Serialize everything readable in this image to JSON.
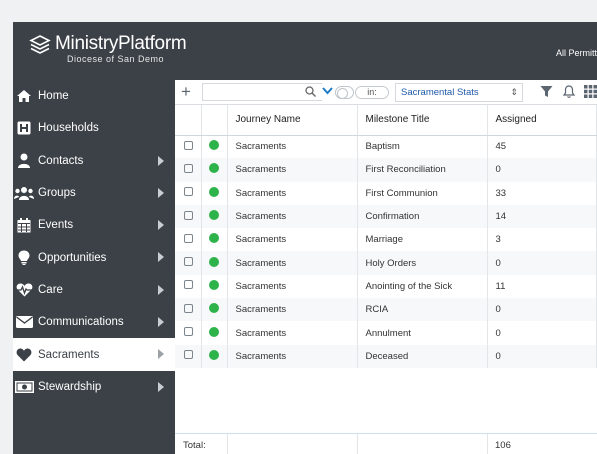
{
  "app": {
    "name": "MinistryPlatform",
    "subtitle": "Diocese of San Demo",
    "permissions": "All Permitt"
  },
  "sidebar": {
    "items": [
      {
        "label": "Home",
        "icon": "home-icon",
        "has_chevron": false
      },
      {
        "label": "Households",
        "icon": "household-icon",
        "has_chevron": false
      },
      {
        "label": "Contacts",
        "icon": "person-icon",
        "has_chevron": true
      },
      {
        "label": "Groups",
        "icon": "group-icon",
        "has_chevron": true
      },
      {
        "label": "Events",
        "icon": "calendar-icon",
        "has_chevron": true
      },
      {
        "label": "Opportunities",
        "icon": "lightbulb-icon",
        "has_chevron": true
      },
      {
        "label": "Care",
        "icon": "heartbeat-icon",
        "has_chevron": true
      },
      {
        "label": "Communications",
        "icon": "envelope-icon",
        "has_chevron": true
      },
      {
        "label": "Sacraments",
        "icon": "heart-icon",
        "has_chevron": true,
        "active": true
      },
      {
        "label": "Stewardship",
        "icon": "money-icon",
        "has_chevron": true
      }
    ]
  },
  "toolbar": {
    "filter_in_label": "in:",
    "selected_view": "Sacramental Stats"
  },
  "table": {
    "columns": [
      "Journey Name",
      "Milestone Title",
      "Assigned"
    ],
    "rows": [
      {
        "journey": "Sacraments",
        "milestone": "Baptism",
        "assigned": "45"
      },
      {
        "journey": "Sacraments",
        "milestone": "First Reconciliation",
        "assigned": "0"
      },
      {
        "journey": "Sacraments",
        "milestone": "First Communion",
        "assigned": "33"
      },
      {
        "journey": "Sacraments",
        "milestone": "Confirmation",
        "assigned": "14"
      },
      {
        "journey": "Sacraments",
        "milestone": "Marriage",
        "assigned": "3"
      },
      {
        "journey": "Sacraments",
        "milestone": "Holy Orders",
        "assigned": "0"
      },
      {
        "journey": "Sacraments",
        "milestone": "Anointing of the Sick",
        "assigned": "11"
      },
      {
        "journey": "Sacraments",
        "milestone": "RCIA",
        "assigned": "0"
      },
      {
        "journey": "Sacraments",
        "milestone": "Annulment",
        "assigned": "0"
      },
      {
        "journey": "Sacraments",
        "milestone": "Deceased",
        "assigned": "0"
      }
    ],
    "footer_label": "Total:",
    "footer_total": "106"
  },
  "colors": {
    "sidebar_bg": "#3b4147",
    "status_green": "#2eb34a",
    "link_blue": "#1e5aa8"
  }
}
